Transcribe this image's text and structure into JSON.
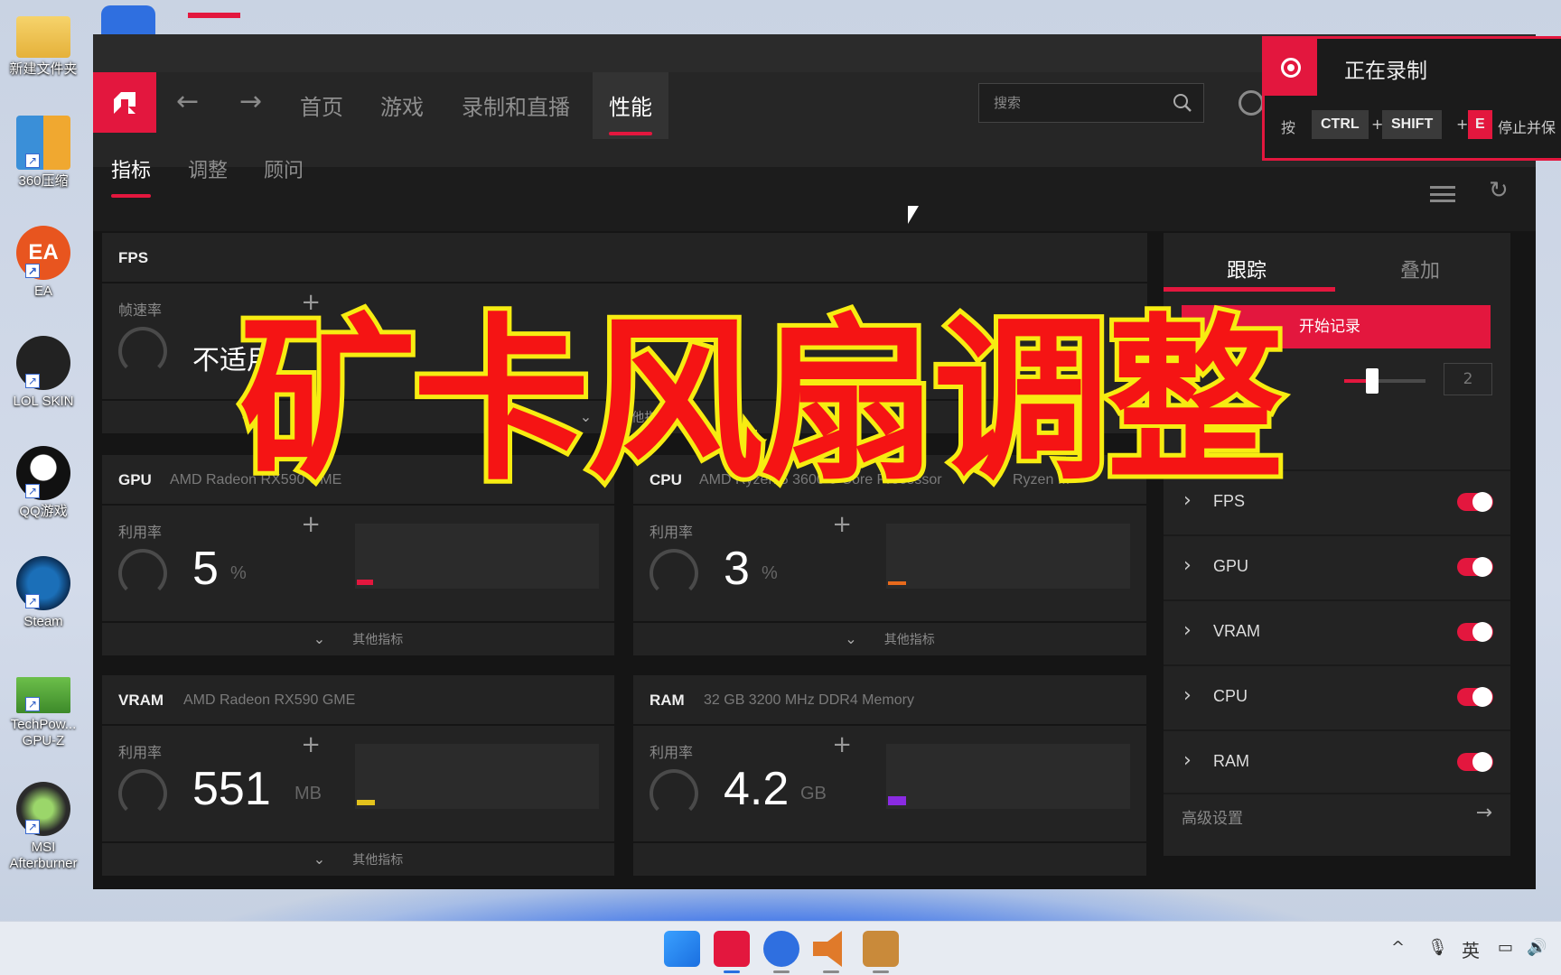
{
  "desktop": {
    "icons": [
      {
        "label": "新建文件夹"
      },
      {
        "label": "360压缩"
      },
      {
        "label": "EA"
      },
      {
        "label": "LOL SKIN"
      },
      {
        "label": "QQ游戏"
      },
      {
        "label": "Steam"
      },
      {
        "label": "TechPow... GPU-Z"
      },
      {
        "label": "MSI Afterburner"
      }
    ]
  },
  "app": {
    "nav": {
      "tabs": [
        "首页",
        "游戏",
        "录制和直播",
        "性能"
      ],
      "active": "性能",
      "search_placeholder": "搜索"
    },
    "subnav": {
      "tabs": [
        "指标",
        "调整",
        "顾问"
      ],
      "active": "指标"
    },
    "fps_card": {
      "title": "FPS",
      "metric_label": "帧速率",
      "value": "不适用",
      "footer": "其他指标"
    },
    "gpu_card": {
      "title": "GPU",
      "subtitle": "AMD Radeon RX590 GME",
      "metric_label": "利用率",
      "value": "5",
      "unit": "%",
      "footer": "其他指标",
      "accent": "#e3173e"
    },
    "cpu_card": {
      "title": "CPU",
      "subtitle": "AMD Ryzen 5 3600 6-Core Processor",
      "subtitle2": "Ryzen ...",
      "metric_label": "利用率",
      "value": "3",
      "unit": "%",
      "footer": "其他指标",
      "accent": "#e86a1c"
    },
    "vram_card": {
      "title": "VRAM",
      "subtitle": "AMD Radeon RX590 GME",
      "metric_label": "利用率",
      "value": "551",
      "unit": "MB",
      "footer": "其他指标",
      "accent": "#e3c21c"
    },
    "ram_card": {
      "title": "RAM",
      "subtitle": "32 GB 3200 MHz DDR4 Memory",
      "metric_label": "利用率",
      "value": "4.2",
      "unit": "GB",
      "accent": "#8a2be2"
    },
    "right_panel": {
      "tabs": [
        "跟踪",
        "叠加"
      ],
      "active": "跟踪",
      "record_button": "开始记录",
      "interval_value": "2",
      "tracked": [
        {
          "label": "FPS",
          "enabled": true
        },
        {
          "label": "GPU",
          "enabled": true
        },
        {
          "label": "VRAM",
          "enabled": true
        },
        {
          "label": "CPU",
          "enabled": true
        },
        {
          "label": "RAM",
          "enabled": true
        }
      ],
      "advanced_label": "高级设置"
    }
  },
  "recording": {
    "status": "正在录制",
    "press": "按",
    "keys": [
      "CTRL",
      "SHIFT",
      "E"
    ],
    "plus": "+",
    "stop_text": "停止并保"
  },
  "overlay_title": "矿卡风扇调整",
  "taskbar": {
    "ime": "英"
  },
  "colors": {
    "accent": "#e3173e",
    "title_fill": "#f51414",
    "title_stroke": "#f7ec12"
  }
}
